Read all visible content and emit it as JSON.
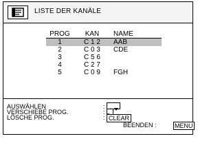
{
  "header": {
    "title": "LISTE DER KANÄLE",
    "icon": "menu-list-icon"
  },
  "table": {
    "columns": [
      "PROG",
      "KAN",
      "NAME"
    ],
    "rows": [
      {
        "prog": "1",
        "kan": "C 1 2",
        "name": "AAB",
        "selected": true
      },
      {
        "prog": "2",
        "kan": "C 0 3",
        "name": "CDE",
        "selected": false
      },
      {
        "prog": "3",
        "kan": "C 5 6",
        "name": "",
        "selected": false
      },
      {
        "prog": "4",
        "kan": "C 2 7",
        "name": "",
        "selected": false
      },
      {
        "prog": "5",
        "kan": "C 0 9",
        "name": "FGH",
        "selected": false
      }
    ]
  },
  "help": {
    "select": "AUSWÄHLEN",
    "move": "VERSCHIEBE PROG.",
    "delete": "LÖSCHE PROG.",
    "colon": ":",
    "clear_key": "CLEAR",
    "exit": "BEENDEN",
    "menu_key": "MENU",
    "exit_colon": ":"
  }
}
